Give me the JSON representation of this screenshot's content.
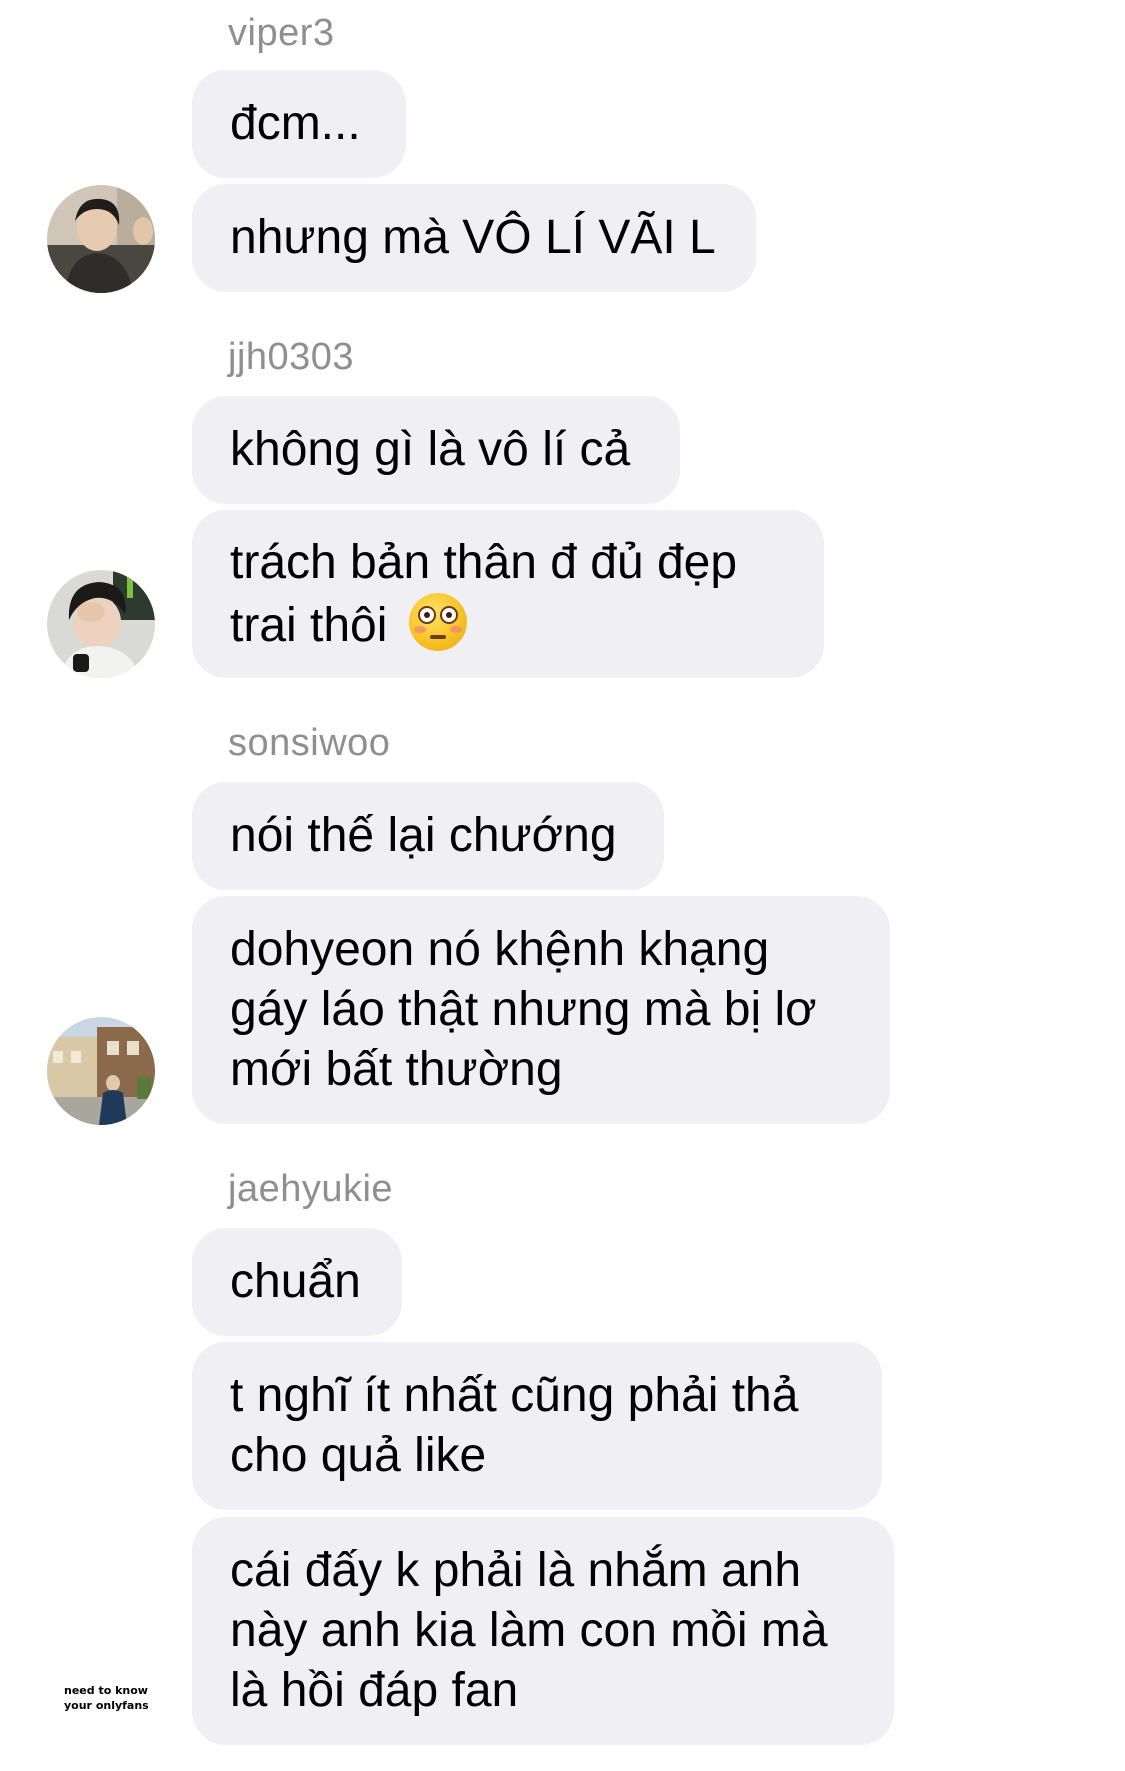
{
  "conversation": [
    {
      "sender": "viper3",
      "avatar_icon": "user-avatar-photo-icon",
      "messages": [
        {
          "lines": [
            "đcm..."
          ]
        },
        {
          "lines": [
            "nhưng mà VÔ LÍ VÃI L"
          ]
        }
      ]
    },
    {
      "sender": "jjh0303",
      "avatar_icon": "user-avatar-photo-icon",
      "messages": [
        {
          "lines": [
            "không gì là vô lí cả"
          ]
        },
        {
          "lines": [
            "trách bản thân đ đủ đẹp",
            "trai thôi"
          ],
          "emoji": "flushed-face-emoji"
        }
      ]
    },
    {
      "sender": "sonsiwoo",
      "avatar_icon": "user-avatar-photo-icon",
      "messages": [
        {
          "lines": [
            "nói thế lại chướng"
          ]
        },
        {
          "lines": [
            "dohyeon nó khệnh khạng",
            "gáy láo thật nhưng mà bị lơ",
            "mới bất thường"
          ]
        }
      ]
    },
    {
      "sender": "jaehyukie",
      "avatar_icon": "watermark-text",
      "messages": [
        {
          "lines": [
            "chuẩn"
          ]
        },
        {
          "lines": [
            "t nghĩ ít nhất cũng phải thả",
            "cho quả like"
          ]
        },
        {
          "lines": [
            "cái đấy k phải là nhắm anh",
            "này anh kia làm con mồi mà",
            "là hồi đáp fan"
          ]
        }
      ]
    }
  ],
  "watermark": {
    "line1": "need to know",
    "line2": "your onlyfans"
  },
  "colors": {
    "bubble_bg": "#efeff4",
    "sender_text": "#8e8e93",
    "message_text": "#000000",
    "background": "#ffffff"
  }
}
